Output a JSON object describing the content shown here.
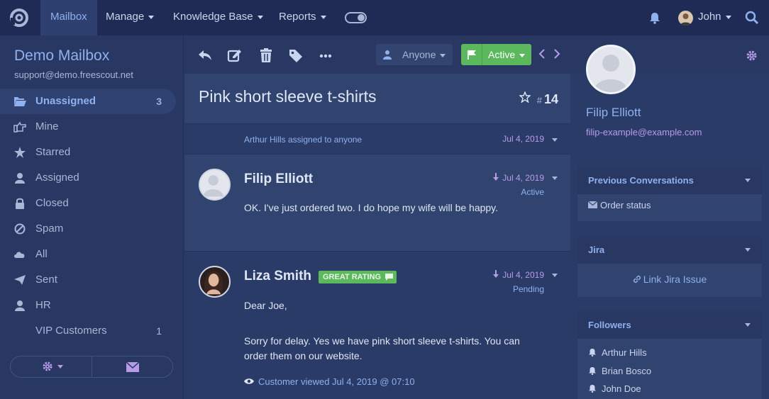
{
  "topnav": {
    "items": [
      {
        "label": "Mailbox"
      },
      {
        "label": "Manage"
      },
      {
        "label": "Knowledge Base"
      },
      {
        "label": "Reports"
      }
    ],
    "user_name": "John"
  },
  "sidebar": {
    "mailbox_name": "Demo Mailbox",
    "mailbox_email": "support@demo.freescout.net",
    "folders": [
      {
        "label": "Unassigned",
        "count": "3",
        "icon": "folder-open-icon"
      },
      {
        "label": "Mine",
        "count": "",
        "icon": "hand-pointing-icon"
      },
      {
        "label": "Starred",
        "count": "",
        "icon": "star-icon"
      },
      {
        "label": "Assigned",
        "count": "",
        "icon": "user-icon"
      },
      {
        "label": "Closed",
        "count": "",
        "icon": "lock-icon"
      },
      {
        "label": "Spam",
        "count": "",
        "icon": "ban-icon"
      },
      {
        "label": "All",
        "count": "",
        "icon": "cloud-icon"
      },
      {
        "label": "Sent",
        "count": "",
        "icon": "send-icon"
      },
      {
        "label": "HR",
        "count": "",
        "icon": "user-icon"
      },
      {
        "label": "VIP Customers",
        "count": "1",
        "icon": ""
      }
    ]
  },
  "toolbar": {
    "assignee_label": "Anyone",
    "status_label": "Active"
  },
  "conversation": {
    "subject": "Pink short sleeve t-shirts",
    "hash": "#",
    "number": "14",
    "line_item": {
      "text": "Arthur Hills assigned to anyone",
      "date": "Jul 4, 2019"
    },
    "threads": [
      {
        "author": "Filip Elliott",
        "date": "Jul 4, 2019",
        "status": "Active",
        "body": [
          "OK. I've just ordered two. I do hope my wife will be happy."
        ]
      },
      {
        "author": "Liza Smith",
        "badge": "GREAT RATING",
        "date": "Jul 4, 2019",
        "status": "Pending",
        "body": [
          "Dear Joe,",
          "Sorry for delay. Yes we have pink short sleeve t-shirts. You can order them on our website."
        ],
        "viewed": "Customer viewed Jul 4, 2019 @ 07:10"
      }
    ]
  },
  "customer": {
    "name": "Filip Elliott",
    "email": "filip-example@example.com"
  },
  "panels": {
    "previous": {
      "title": "Previous Conversations",
      "items": [
        "Order status"
      ]
    },
    "jira": {
      "title": "Jira",
      "link": "Link Jira Issue"
    },
    "followers": {
      "title": "Followers",
      "items": [
        "Arthur Hills",
        "Brian Bosco",
        "John Doe"
      ]
    }
  },
  "colors": {
    "accent": "#8fb1ee",
    "active_green": "#5cb85c",
    "date_purple": "#b89be8"
  }
}
